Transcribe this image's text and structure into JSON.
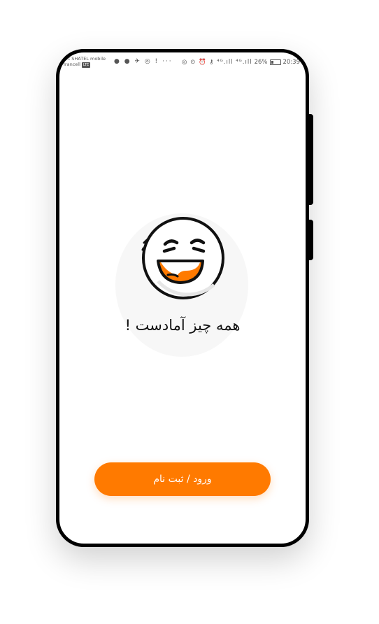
{
  "status_bar": {
    "carrier_line1": "art SHATEL mobile",
    "carrier_line2": "Irancell",
    "carrier_badge": "LTE",
    "left_icons": "● ● ✈ ◎ ! ···",
    "right_icons": "◎ ⊙ ⏰ ⚷ ⁴ᴳ.ıll ⁴ᴳ.ıll",
    "battery_percent": "26%",
    "battery_level": 0.26,
    "time": "20:39"
  },
  "main": {
    "illustration_icon": "laughing-face-icon",
    "headline": "همه چیز آمادست !",
    "cta_label": "ورود / ثبت نام"
  },
  "colors": {
    "accent": "#ff7a00",
    "frame": "#000000",
    "background": "#ffffff"
  }
}
